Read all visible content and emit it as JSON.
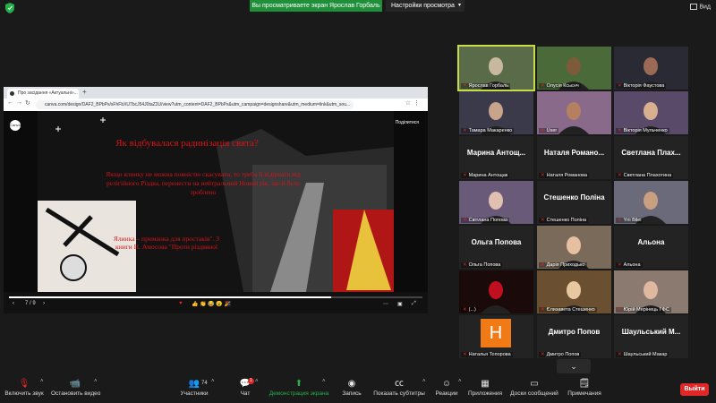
{
  "topbar": {
    "share_banner": "Вы просматриваете экран Ярослав Горбаль",
    "view_options": "Настройки просмотра",
    "view_button": "Вид"
  },
  "browser": {
    "tab_title": "Про засідання «Актуальні»...",
    "url": "canva.com/design/DAF2_BPbPs/sFhFbXU7bcJ54J0taZ3U/view?utm_content=DAF2_BPbPs&utm_campaign=designshare&utm_medium=link&utm_sou..."
  },
  "slide": {
    "title": "Як відбувалася радинізація свята?",
    "body": "Якщо ялинку не можна повністю скасувати, то треба її відірвати від релігійного Різдва, перенести на нейтральний Новий рік, що й було зроблено",
    "caption": "Ялинка – приманка для простаків\". З книги Н. Амосова \"Проти різдвяної",
    "share_label": "Поділитися",
    "page_indicator": "7 / 9",
    "progress_fraction": 0.78
  },
  "participants": [
    {
      "caption": "Ярослав Горбаль",
      "video": true,
      "active": true
    },
    {
      "caption": "Олусія Ксьєнч",
      "video": true
    },
    {
      "caption": "Вікторія Фаустова",
      "video": true
    },
    {
      "caption": "Тамара Макаренко",
      "video": true
    },
    {
      "caption": "User",
      "video": true
    },
    {
      "caption": "Вікторія Мульченко",
      "video": true
    },
    {
      "caption": "Марина Антощак",
      "big": "Марина Антощ...",
      "video": false
    },
    {
      "caption": "Наталя Романова",
      "big": "Наталя Романо...",
      "video": false
    },
    {
      "caption": "Светлана Плахотина",
      "big": "Светлана Плах...",
      "video": false
    },
    {
      "caption": "Світлана Попова",
      "video": true
    },
    {
      "caption": "Стешенко Поліна",
      "big": "Стешенко Поліна",
      "video": false
    },
    {
      "caption": "Yrii Bilei",
      "video": true
    },
    {
      "caption": "Ольга Попова",
      "big": "Ольга Попова",
      "video": false
    },
    {
      "caption": "Дарія Приходько",
      "video": true
    },
    {
      "caption": "Альона",
      "big": "Альона",
      "video": false
    },
    {
      "caption": "(...)",
      "video": true
    },
    {
      "caption": "Єлизавета Стешенко",
      "video": true
    },
    {
      "caption": "Юрій Мерінець ГФС",
      "video": true
    },
    {
      "caption": "Наталья Топорова",
      "big": "H",
      "video": false,
      "avatar": true
    },
    {
      "caption": "Дмитро Попов",
      "big": "Дмитро Попов",
      "video": false
    },
    {
      "caption": "Шаульський Макар",
      "big": "Шаульський М...",
      "video": false
    }
  ],
  "toolbar": {
    "mute": "Включить звук",
    "video": "Остановить видео",
    "participants": "Участники",
    "participants_count": "74",
    "chat": "Чат",
    "chat_badge": "1",
    "share": "Демонстрация экрана",
    "record": "Запись",
    "captions": "Показать субтитры",
    "reactions": "Реакции",
    "apps": "Приложения",
    "whiteboard": "Доски сообщений",
    "notes": "Примечания",
    "leave": "Выйти"
  },
  "colors": {
    "accent_green": "#23b04a",
    "leave_red": "#e02828",
    "slide_red": "#d6141a",
    "active_speaker": "#c7dd47"
  }
}
